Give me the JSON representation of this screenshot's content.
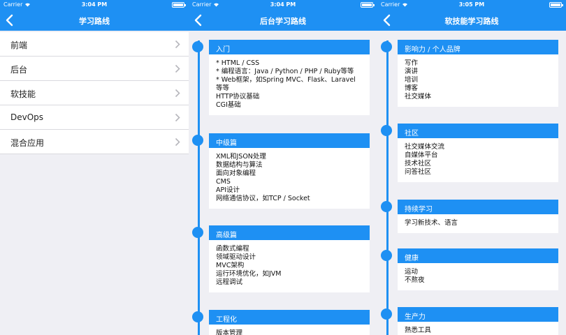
{
  "status": {
    "carrier": "Carrier"
  },
  "screens": [
    {
      "time": "3:04 PM",
      "title": "学习路线",
      "menu": [
        {
          "label": "前端"
        },
        {
          "label": "后台"
        },
        {
          "label": "软技能"
        },
        {
          "label": "DevOps"
        },
        {
          "label": "混合应用"
        }
      ]
    },
    {
      "time": "3:04 PM",
      "title": "后台学习路线",
      "sections": [
        {
          "header": "入门",
          "lines": [
            "* HTML / CSS",
            "* 编程语言：Java / Python / PHP / Ruby等等",
            "* Web框架，如Spring MVC、Flask、Laravel",
            "等等",
            "HTTP协议基础",
            "CGI基础"
          ]
        },
        {
          "header": "中级篇",
          "lines": [
            "XML和JSON处理",
            "数据结构与算法",
            "面向对象编程",
            "CMS",
            "API设计",
            "网络通信协议，如TCP / Socket"
          ]
        },
        {
          "header": "高级篇",
          "lines": [
            "函数式编程",
            "领域驱动设计",
            "MVC架构",
            "运行环境优化，如JVM",
            "远程调试"
          ]
        },
        {
          "header": "工程化",
          "lines": [
            "版本管理"
          ]
        }
      ]
    },
    {
      "time": "3:05 PM",
      "title": "软技能学习路线",
      "sections": [
        {
          "header": "影响力 / 个人品牌",
          "lines": [
            "写作",
            "演讲",
            "培训",
            "博客",
            "社交媒体"
          ]
        },
        {
          "header": "社区",
          "lines": [
            "社交媒体交流",
            "自媒体平台",
            "技术社区",
            "问答社区"
          ]
        },
        {
          "header": "持续学习",
          "lines": [
            "学习新技术、语言"
          ]
        },
        {
          "header": "健康",
          "lines": [
            "运动",
            "不熬夜"
          ]
        },
        {
          "header": "生产力",
          "lines": [
            "熟悉工具"
          ]
        }
      ]
    }
  ]
}
